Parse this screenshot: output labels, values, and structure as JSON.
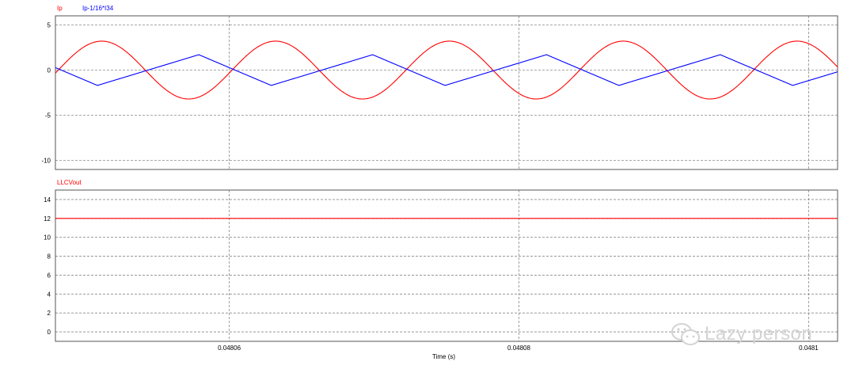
{
  "chart_data": [
    {
      "type": "line",
      "xlim": [
        0.048048,
        0.048102
      ],
      "ylim": [
        -11,
        6
      ],
      "yticks": [
        5,
        0,
        -5,
        -10
      ],
      "ytick_labels": [
        "5",
        "0",
        "-5",
        "-10"
      ],
      "grid": true,
      "legend_position": "top-left",
      "series": [
        {
          "name": "Ip",
          "color": "#ff0000",
          "shape": "sine",
          "amplitude": 3.2,
          "period": 1.2e-05,
          "peak_at": 0.0480512
        },
        {
          "name": "Ip-1/16*I34",
          "color": "#0000ff",
          "shape": "triangle",
          "max": 1.7,
          "min": -1.7,
          "max_at": 0.0480579,
          "min_at": 0.0480509,
          "period": 1.2e-05
        }
      ]
    },
    {
      "type": "line",
      "xlim": [
        0.048048,
        0.048102
      ],
      "ylim": [
        -1,
        15
      ],
      "yticks": [
        14,
        12,
        10,
        8,
        6,
        4,
        2,
        0
      ],
      "ytick_labels": [
        "14",
        "12",
        "10",
        "8",
        "6",
        "4",
        "2",
        "0"
      ],
      "grid": true,
      "legend_position": "top-left",
      "series": [
        {
          "name": "LLCVout",
          "color": "#ff0000",
          "shape": "constant",
          "value": 12
        }
      ]
    }
  ],
  "x_axis": {
    "xlabel": "Time (s)",
    "xticks": [
      0.04806,
      0.04808,
      0.0481
    ],
    "xtick_labels": [
      "0.04806",
      "0.04808",
      "0.0481"
    ]
  },
  "watermark": {
    "text": "Lazy person"
  }
}
